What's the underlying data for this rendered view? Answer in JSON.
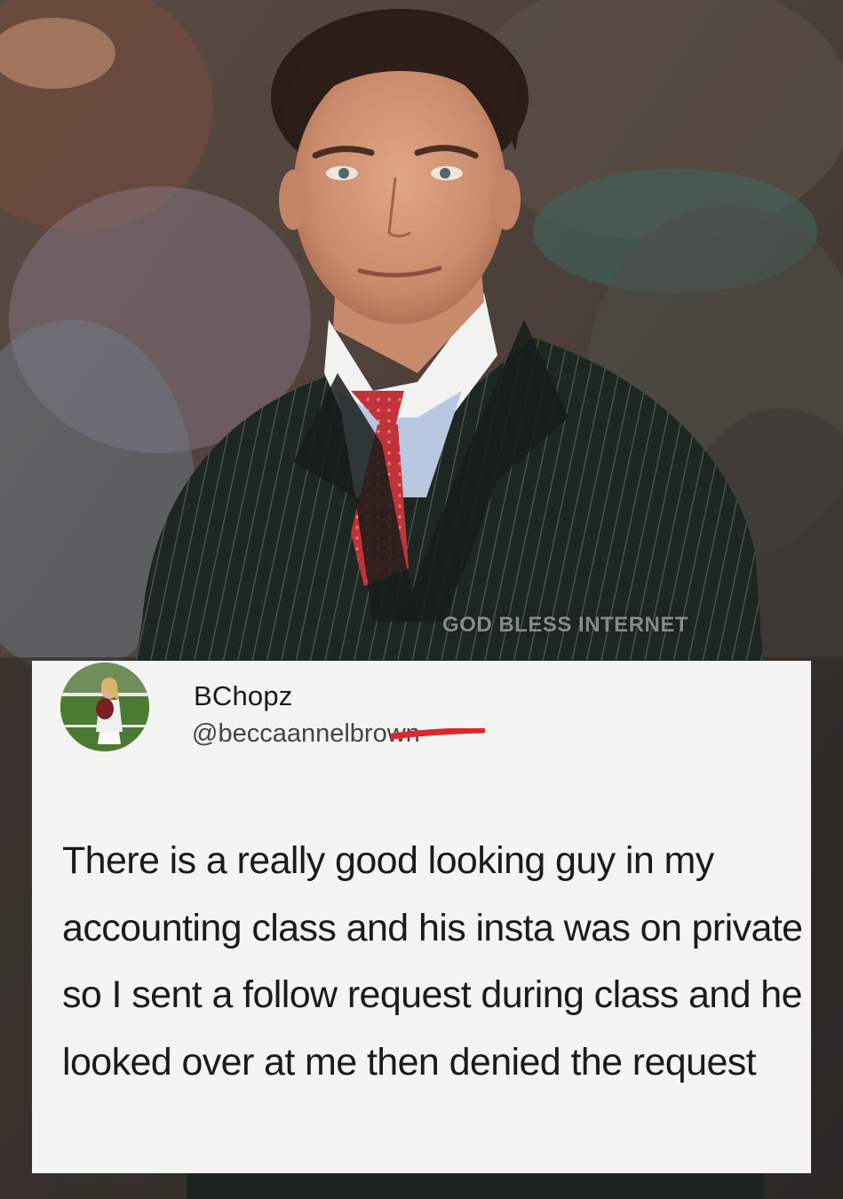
{
  "watermark": "GOD BLESS INTERNET",
  "tweet": {
    "display_name": "BChopz",
    "handle": "@beccaannelbrown",
    "text": "There is a really good looking guy in my accounting class and his insta was on private so I sent a follow request during class and he looked over at me then denied the request"
  },
  "colors": {
    "card_background": "#f4f4f3",
    "text": "#1b1b1b",
    "redaction": "#e0262b",
    "suit": "#1d2420",
    "tie": "#c8343c"
  },
  "icons": {
    "avatar": "profile-photo"
  }
}
